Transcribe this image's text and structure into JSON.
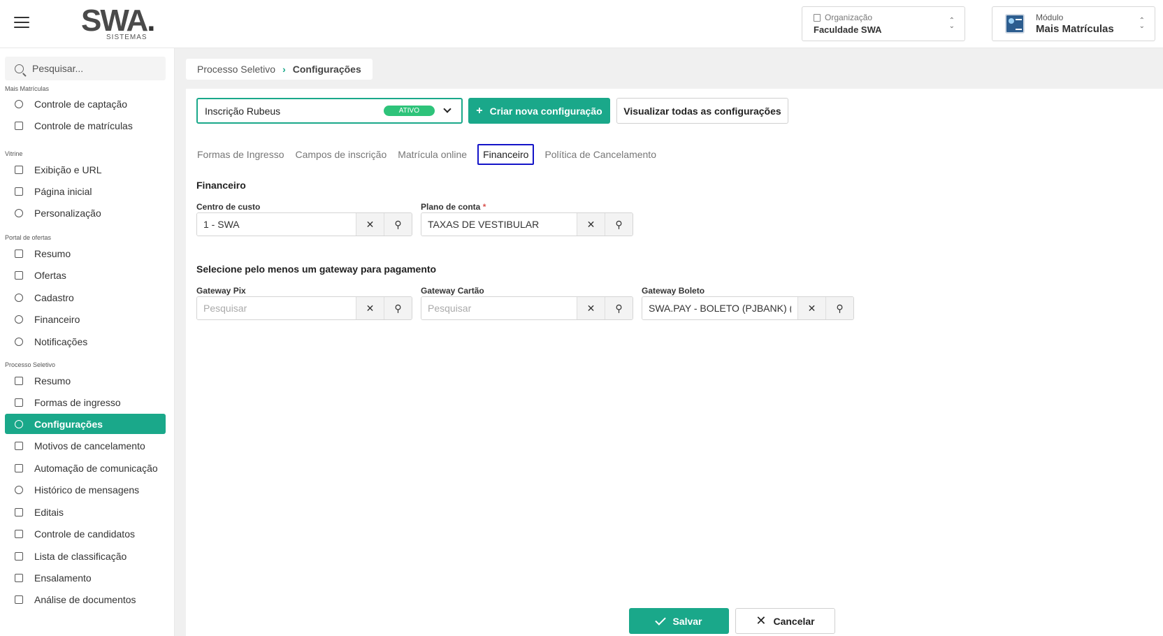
{
  "header": {
    "logo_text": "SWA",
    "logo_sub": "SISTEMAS",
    "organization": {
      "label": "Organização",
      "value": "Faculdade SWA"
    },
    "module": {
      "label": "Módulo",
      "value": "Mais Matrículas"
    }
  },
  "sidebar": {
    "search_placeholder": "Pesquisar...",
    "sections": {
      "mais_matriculas": "Mais Matrículas",
      "vitrine": "Vitrine",
      "portal": "Portal de ofertas",
      "processo": "Processo Seletivo"
    },
    "items": {
      "controle_captacao": "Controle de captação",
      "controle_matriculas": "Controle de matrículas",
      "exibicao_url": "Exibição e URL",
      "pagina_inicial": "Página inicial",
      "personalizacao": "Personalização",
      "portal_resumo": "Resumo",
      "ofertas": "Ofertas",
      "cadastro": "Cadastro",
      "financeiro": "Financeiro",
      "notificacoes": "Notificações",
      "ps_resumo": "Resumo",
      "formas_ingresso": "Formas de ingresso",
      "configuracoes": "Configurações",
      "motivos_cancelamento": "Motivos de cancelamento",
      "automacao": "Automação de comunicação",
      "historico": "Histórico de mensagens",
      "editais": "Editais",
      "controle_candidatos": "Controle de candidatos",
      "lista_classificacao": "Lista de classificação",
      "ensalamento": "Ensalamento",
      "analise_documentos": "Análise de documentos"
    }
  },
  "breadcrumb": {
    "parent": "Processo Seletivo",
    "current": "Configurações"
  },
  "config": {
    "selected": "Inscrição Rubeus",
    "status": "ATIVO",
    "create_label": "Criar nova configuração",
    "view_all_label": "Visualizar todas as configurações"
  },
  "tabs": {
    "formas": "Formas de Ingresso",
    "campos": "Campos de inscrição",
    "matricula": "Matrícula online",
    "financeiro": "Financeiro",
    "politica": "Política de Cancelamento"
  },
  "form": {
    "section_title": "Financeiro",
    "centro_custo": {
      "label": "Centro de custo",
      "value": "1 - SWA"
    },
    "plano_conta": {
      "label": "Plano de conta",
      "required": "*",
      "value": "TAXAS DE VESTIBULAR"
    },
    "gateway_title": "Selecione pelo menos um gateway para pagamento",
    "gateway_pix": {
      "label": "Gateway Pix",
      "placeholder": "Pesquisar",
      "value": ""
    },
    "gateway_cartao": {
      "label": "Gateway Cartão",
      "placeholder": "Pesquisar",
      "value": ""
    },
    "gateway_boleto": {
      "label": "Gateway Boleto",
      "value": "SWA.PAY - BOLETO (PJBANK) (PJBANK)"
    }
  },
  "actions": {
    "save": "Salvar",
    "cancel": "Cancelar"
  },
  "colors": {
    "accent": "#1aa88a",
    "badge": "#2ec37a",
    "tab_focus": "#1414c8"
  }
}
